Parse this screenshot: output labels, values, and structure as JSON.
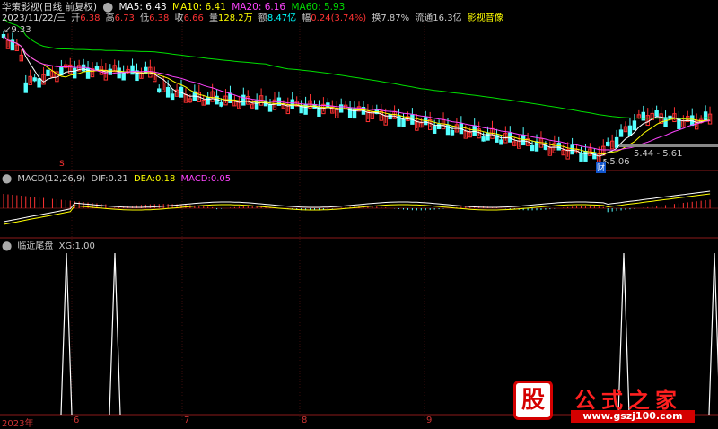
{
  "header": {
    "title": "华策影视(日线 前复权)",
    "date": "2023/11/22/三",
    "open_label": "开",
    "open": "6.38",
    "high_label": "高",
    "high": "6.73",
    "low_label": "低",
    "low": "6.38",
    "close_label": "收",
    "close": "6.66",
    "vol_label": "量",
    "vol": "128.2万",
    "amount_label": "额",
    "amount": "8.47亿",
    "change_label": "幅",
    "change": "0.24(3.74%)",
    "turnover_label": "换",
    "turnover": "7.87%",
    "float_label": "流通",
    "float": "16.3亿",
    "sector": "影视音像"
  },
  "ma": {
    "ma5_label": "MA5:",
    "ma5": "6.43",
    "ma10_label": "MA10:",
    "ma10": "6.41",
    "ma20_label": "MA20:",
    "ma20": "6.16",
    "ma60_label": "MA60:",
    "ma60": "5.93"
  },
  "price_labels": {
    "high_mark": "9.33",
    "low_mark": "5.06",
    "range_mark": "5.44 - 5.61",
    "cai_badge": "财",
    "s_badge": "S"
  },
  "macd": {
    "title": "MACD(12,26,9)",
    "dif_label": "DIF:",
    "dif": "0.21",
    "dea_label": "DEA:",
    "dea": "0.18",
    "macd_label": "MACD:",
    "macd": "0.05"
  },
  "indicator": {
    "title": "临近尾盘",
    "xg_label": "XG:",
    "xg": "1.00"
  },
  "xaxis": {
    "year": "2023年",
    "months": [
      "6",
      "7",
      "8",
      "9"
    ]
  },
  "watermark": {
    "gu": "股",
    "title": "公式之家",
    "url": "www.gszj100.com"
  },
  "colors": {
    "ma5": "#ffffff",
    "ma10": "#ffff00",
    "ma20": "#ff44ff",
    "ma60": "#00dd00",
    "up": "#ff3232",
    "down": "#54ffff",
    "header_title": "#dddddd"
  }
}
